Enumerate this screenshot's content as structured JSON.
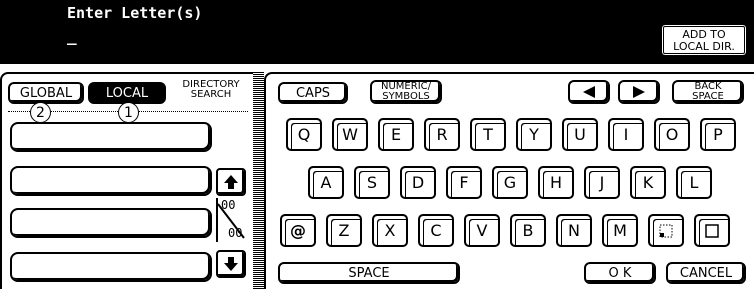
{
  "header": {
    "title": "Enter Letter(s)",
    "cursor": "_",
    "add_button_line1": "ADD TO",
    "add_button_line2": "LOCAL DIR."
  },
  "left_panel": {
    "global_label": "GLOBAL",
    "local_label": "LOCAL",
    "dir_search_line1": "DIRECTORY",
    "dir_search_line2": "SEARCH",
    "marker_global": "2",
    "marker_local": "1",
    "page_current": "00",
    "page_total": "00",
    "up_icon": "arrow-up-icon",
    "down_icon": "arrow-down-icon"
  },
  "keyboard": {
    "caps_label": "CAPS",
    "numeric_line1": "NUMERIC/",
    "numeric_line2": "SYMBOLS",
    "back_line1": "BACK",
    "back_line2": "SPACE",
    "row1": [
      "Q",
      "W",
      "E",
      "R",
      "T",
      "Y",
      "U",
      "I",
      "O",
      "P"
    ],
    "row2": [
      "A",
      "S",
      "D",
      "F",
      "G",
      "H",
      "J",
      "K",
      "L"
    ],
    "row3": [
      "@",
      "Z",
      "X",
      "C",
      "V",
      "B",
      "N",
      "M"
    ],
    "space_label": "SPACE",
    "ok_label": "O K",
    "cancel_label": "CANCEL"
  }
}
